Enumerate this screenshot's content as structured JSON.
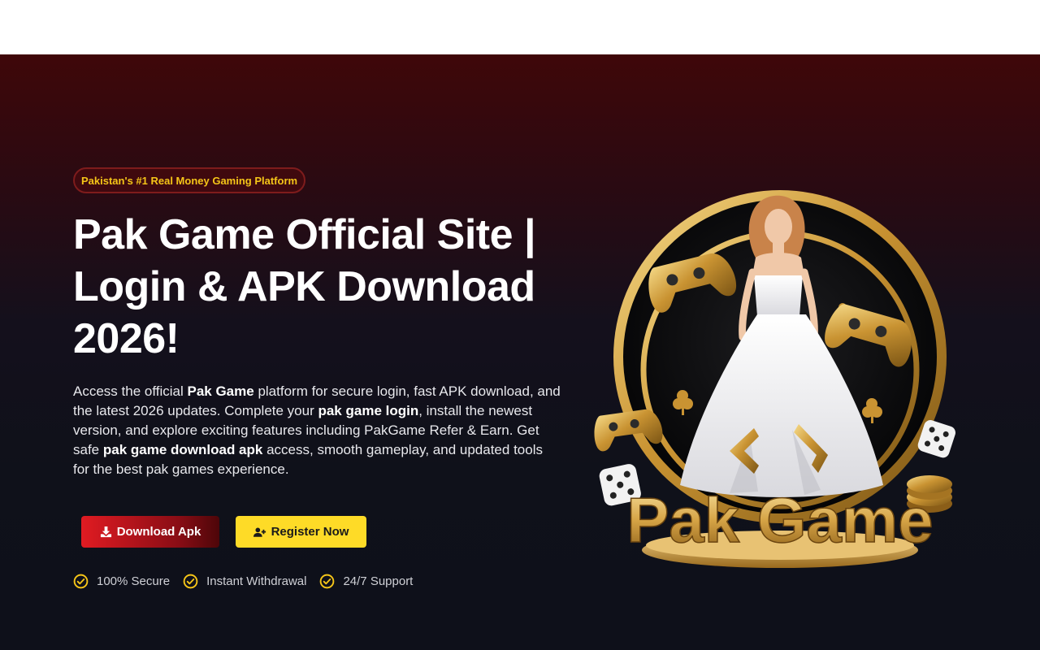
{
  "header": {},
  "hero": {
    "badge": "Pakistan's #1 Real Money Gaming Platform",
    "title": "Pak Game Official Site | Login & APK Download 2026!",
    "description": {
      "p1": "Access the official ",
      "b1": "Pak Game",
      "p2": " platform for secure login, fast APK download, and the latest 2026 updates. Complete your ",
      "b2": "pak game login",
      "p3": ", install the newest version, and explore exciting features including PakGame Refer & Earn. Get safe ",
      "b3": "pak game download apk",
      "p4": " access, smooth gameplay, and updated tools for the best pak games experience."
    },
    "buttons": {
      "download_label": "Download Apk",
      "register_label": "Register Now"
    },
    "features": [
      "100% Secure",
      "Instant Withdrawal",
      "24/7 Support"
    ],
    "logo_text": "Pak Game"
  },
  "colors": {
    "accent_yellow": "#fedb27",
    "accent_red": "#e01b22",
    "background_dark": "#0f111a",
    "gold": "#d4a545"
  },
  "icons": {
    "download": "download-icon",
    "register": "user-plus-icon",
    "check": "check-circle-icon"
  }
}
